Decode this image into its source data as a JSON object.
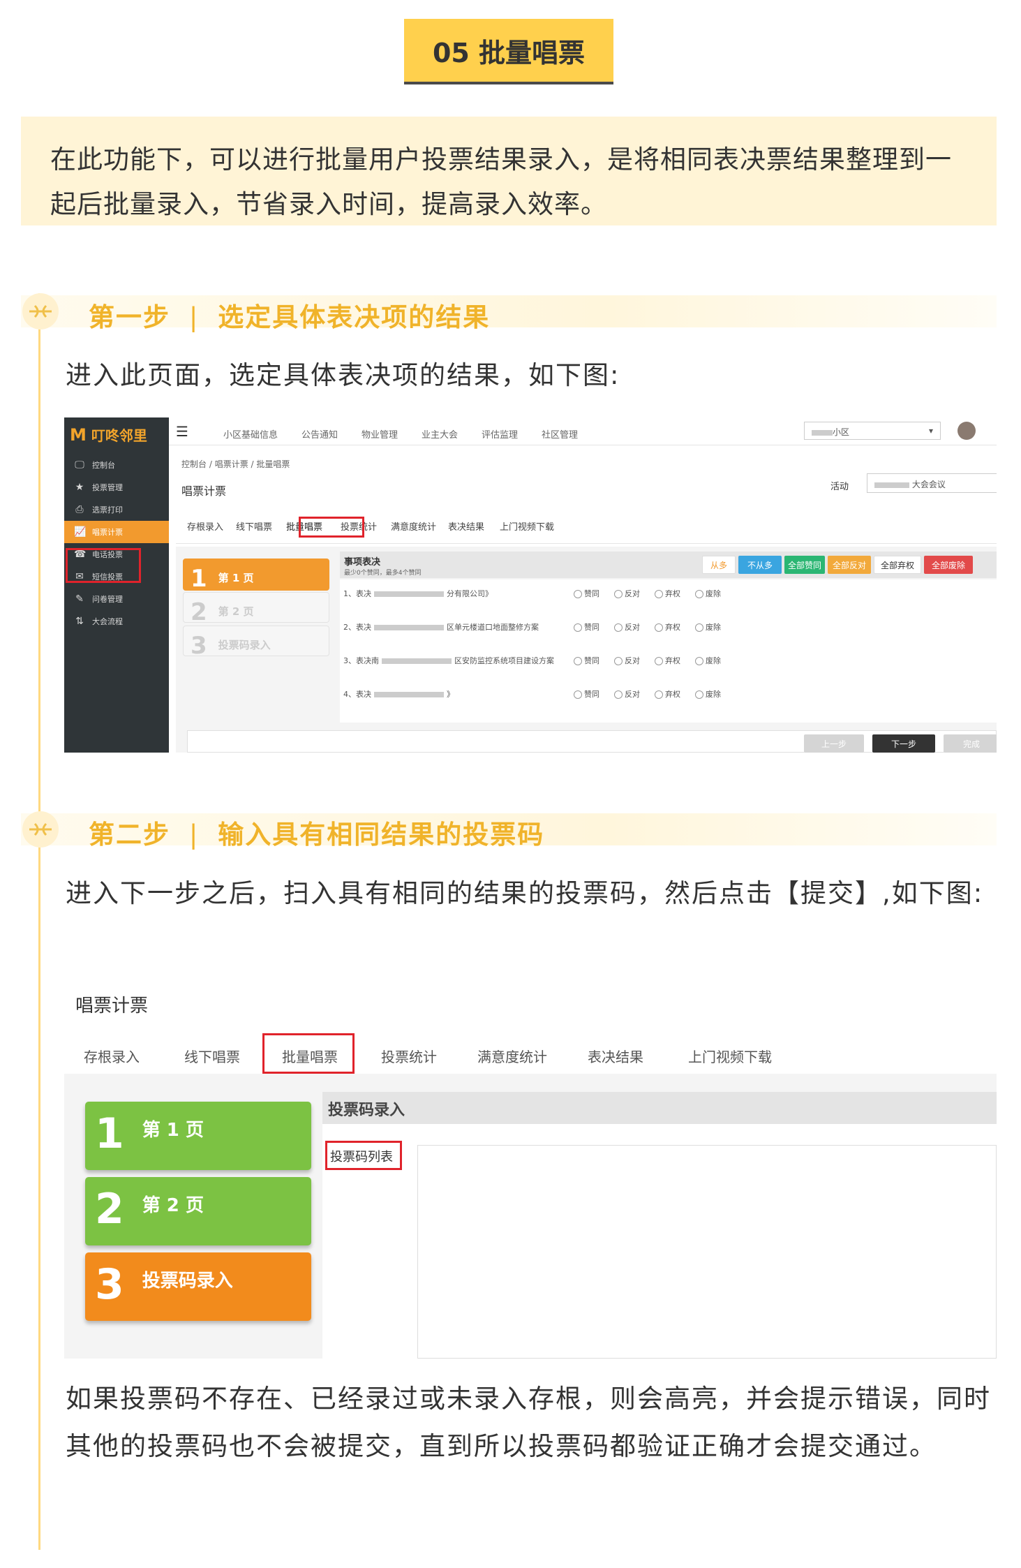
{
  "title": "05 批量唱票",
  "intro": "在此功能下，可以进行批量用户投票结果录入，是将相同表决票结果整理到一起后批量录入，节省录入时间，提高录入效率。",
  "step1": {
    "label": "第一步",
    "divider": "|",
    "heading": "选定具体表决项的结果",
    "text": "进入此页面，选定具体表决项的结果，如下图:"
  },
  "shot1": {
    "logo": "叮咚邻里",
    "sidebar": [
      {
        "icon": "monitor-icon",
        "glyph": "🖵",
        "label": "控制台"
      },
      {
        "icon": "star-icon",
        "glyph": "★",
        "label": "投票管理"
      },
      {
        "icon": "printer-icon",
        "glyph": "⎙",
        "label": "选票打印"
      },
      {
        "icon": "chart-icon",
        "glyph": "📈",
        "label": "唱票计票"
      },
      {
        "icon": "headset-icon",
        "glyph": "☎",
        "label": "电话投票"
      },
      {
        "icon": "mail-icon",
        "glyph": "✉",
        "label": "短信投票"
      },
      {
        "icon": "edit-icon",
        "glyph": "✎",
        "label": "问卷管理"
      },
      {
        "icon": "sort-icon",
        "glyph": "⇅",
        "label": "大会流程"
      }
    ],
    "topnav": [
      "小区基础信息",
      "公告通知",
      "物业管理",
      "业主大会",
      "评估监理",
      "社区管理"
    ],
    "community_select": "小区",
    "breadcrumb": [
      "控制台",
      "唱票计票",
      "批量唱票"
    ],
    "page_title": "唱票计票",
    "activity_label": "活动",
    "activity_value": "大会会议",
    "tabs": [
      "存根录入",
      "线下唱票",
      "批量唱票",
      "投票统计",
      "满意度统计",
      "表决结果",
      "上门视频下载"
    ],
    "wizard": [
      {
        "num": "1",
        "label": "第 1 页"
      },
      {
        "num": "2",
        "label": "第 2 页"
      },
      {
        "num": "3",
        "label": "投票码录入"
      }
    ],
    "section_title": "事项表决",
    "section_sub": "最少0个赞同，最多4个赞同",
    "bulk_buttons": [
      "从多",
      "不从多",
      "全部赞同",
      "全部反对",
      "全部弃权",
      "全部废除"
    ],
    "bulk_colors": [
      "#ffffff",
      "#3aa5e0",
      "#2bb673",
      "#f2a93b",
      "#ffffff",
      "#e24a4a"
    ],
    "questions": [
      {
        "prefix": "1、表决",
        "tail": "分有限公司》"
      },
      {
        "prefix": "2、表决",
        "tail": "区单元楼道口地面整修方案"
      },
      {
        "prefix": "3、表决南",
        "tail": "区安防监控系统项目建设方案"
      },
      {
        "prefix": "4、表决",
        "tail": "》"
      }
    ],
    "options": [
      "赞同",
      "反对",
      "弃权",
      "废除"
    ],
    "footer_buttons": [
      "上一步",
      "下一步",
      "完成"
    ]
  },
  "step2": {
    "label": "第二步",
    "divider": "|",
    "heading": "输入具有相同结果的投票码",
    "text": "进入下一步之后，扫入具有相同的结果的投票码，然后点击【提交】,如下图:"
  },
  "shot2": {
    "page_title": "唱票计票",
    "tabs": [
      "存根录入",
      "线下唱票",
      "批量唱票",
      "投票统计",
      "满意度统计",
      "表决结果",
      "上门视频下载"
    ],
    "wizard": [
      {
        "num": "1",
        "label": "第 1 页"
      },
      {
        "num": "2",
        "label": "第 2 页"
      },
      {
        "num": "3",
        "label": "投票码录入"
      }
    ],
    "panel_title": "投票码录入",
    "list_label": "投票码列表"
  },
  "closing": "如果投票码不存在、已经录过或未录入存根，则会高亮，并会提示错误，同时其他的投票码也不会被提交，直到所以投票码都验证正确才会提交通过。",
  "colors": {
    "accent": "#ffd04d",
    "step_text": "#f0b32a",
    "orange": "#f29a2e",
    "green": "#7cc243",
    "red": "#e0232b"
  }
}
